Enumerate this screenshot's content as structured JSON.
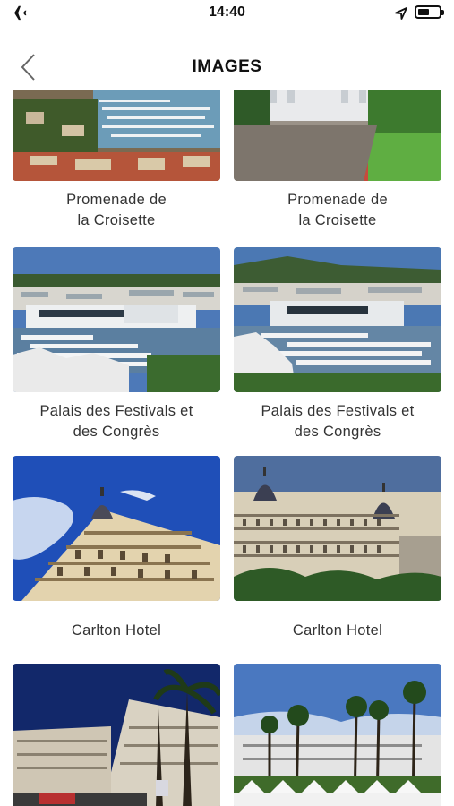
{
  "status_bar": {
    "time": "14:40",
    "left_icon": "airplane-icon",
    "right_icons": [
      "location-arrow-icon",
      "battery-icon"
    ],
    "battery_level": 0.45
  },
  "nav": {
    "title": "IMAGES",
    "back_icon": "chevron-left-icon"
  },
  "cards": [
    {
      "line1": "Promenade de",
      "line2": "la Croisette"
    },
    {
      "line1": "Promenade de",
      "line2": "la Croisette"
    },
    {
      "line1": "Palais des Festivals et",
      "line2": "des Congrès"
    },
    {
      "line1": "Palais des Festivals et",
      "line2": "des Congrès"
    },
    {
      "line1": "Carlton Hotel",
      "line2": ""
    },
    {
      "line1": "Carlton Hotel",
      "line2": ""
    },
    {
      "line1": "",
      "line2": ""
    },
    {
      "line1": "",
      "line2": ""
    }
  ],
  "colors": {
    "accent": "#111111",
    "caption_text": "#333333",
    "background": "#ffffff"
  }
}
